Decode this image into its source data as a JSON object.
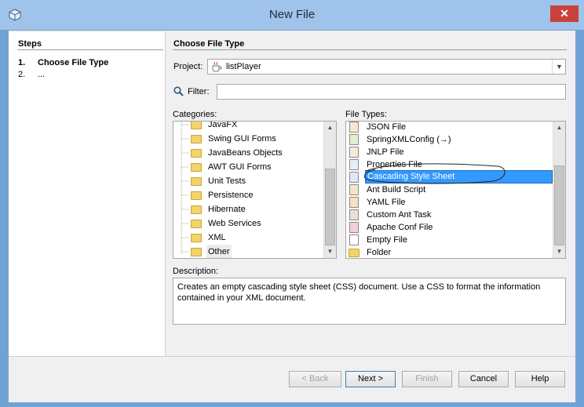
{
  "window": {
    "title": "New File",
    "close_glyph": "✕"
  },
  "steps": {
    "title": "Steps",
    "items": [
      {
        "num": "1.",
        "label": "Choose File Type"
      },
      {
        "num": "2.",
        "label": "..."
      }
    ]
  },
  "main": {
    "header": "Choose File Type",
    "project_label": "Project:",
    "project_value": "listPlayer",
    "filter_label": "Filter:",
    "filter_value": "",
    "categories_label": "Categories:",
    "categories": [
      "JavaFX",
      "Swing GUI Forms",
      "JavaBeans Objects",
      "AWT GUI Forms",
      "Unit Tests",
      "Persistence",
      "Hibernate",
      "Web Services",
      "XML",
      "Other"
    ],
    "file_types_label": "File Types:",
    "file_types": [
      "JSON File",
      "SpringXMLConfig (→)",
      "JNLP File",
      "Properties File",
      "Cascading Style Sheet",
      "Ant Build Script",
      "YAML File",
      "Custom Ant Task",
      "Apache Conf File",
      "Empty File",
      "Folder"
    ],
    "selected_file_type": "Cascading Style Sheet",
    "description_label": "Description:",
    "description": "Creates an empty cascading style sheet (CSS) document. Use a CSS to format the information contained in your XML document."
  },
  "buttons": {
    "back": "< Back",
    "next": "Next >",
    "finish": "Finish",
    "cancel": "Cancel",
    "help": "Help"
  },
  "colors": {
    "selection": "#3399ff",
    "titlebar": "#9fc3ea",
    "close": "#c9413b"
  }
}
